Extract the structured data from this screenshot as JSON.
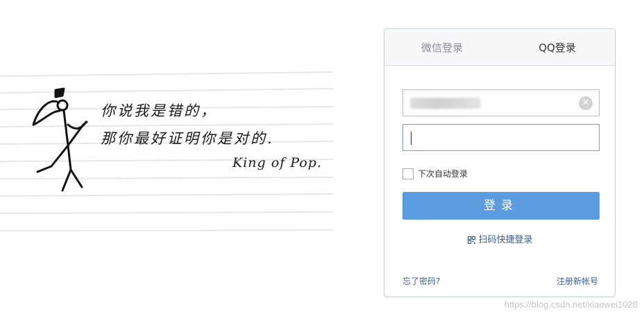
{
  "art": {
    "line1": "你说我是错的，",
    "line2": "那你最好证明你是对的.",
    "line3": "King of Pop."
  },
  "tabs": [
    {
      "label": "微信登录",
      "active": false
    },
    {
      "label": "QQ登录",
      "active": true
    }
  ],
  "form": {
    "username_value": "",
    "password_value": "",
    "clear_icon": "close-icon",
    "remember_label": "下次自动登录",
    "login_label": "登录"
  },
  "links": {
    "qr_login": "扫码快捷登录",
    "forgot": "忘了密码?",
    "register": "注册新帐号"
  },
  "watermark": "https://blog.csdn.net/xiaowei1028",
  "colors": {
    "accent": "#5b9be0",
    "link": "#3d5f8c",
    "tab_bg": "#f7f8fa"
  }
}
